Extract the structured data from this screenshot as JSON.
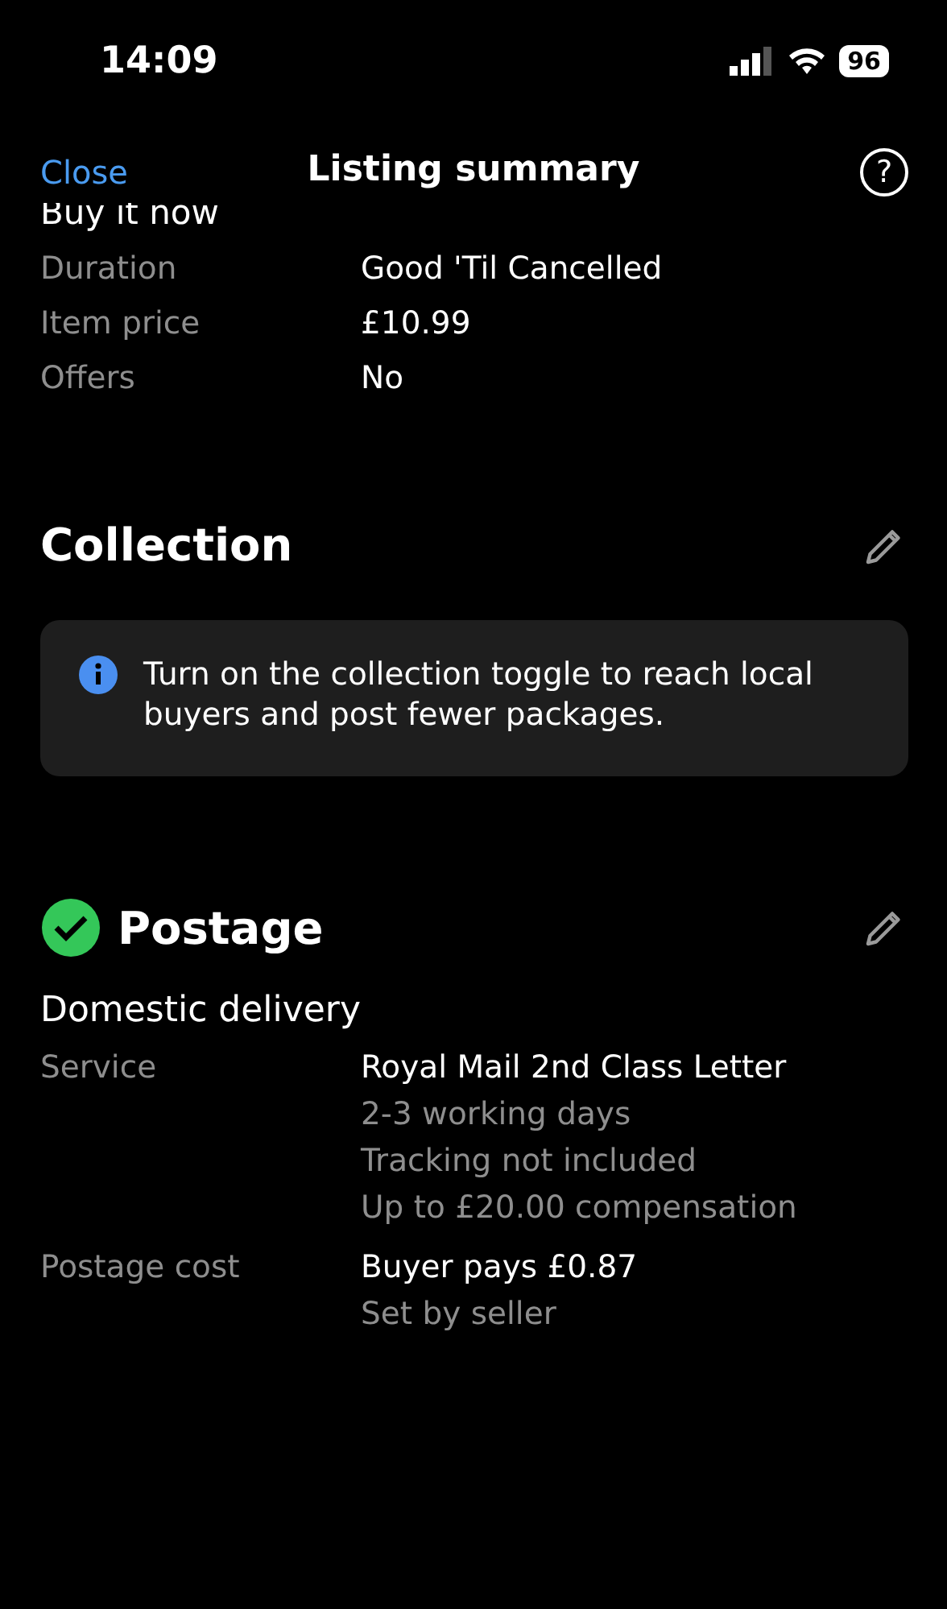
{
  "status_bar": {
    "time": "14:09",
    "battery": "96"
  },
  "nav": {
    "close": "Close",
    "title": "Listing summary",
    "help": "?"
  },
  "buy_it_now": {
    "heading": "Buy it now",
    "rows": [
      {
        "label": "Duration",
        "values": [
          "Good 'Til Cancelled"
        ]
      },
      {
        "label": "Item price",
        "values": [
          "£10.99"
        ]
      },
      {
        "label": "Offers",
        "values": [
          "No"
        ]
      }
    ]
  },
  "collection": {
    "heading": "Collection",
    "complete": false,
    "info": "Turn on the collection toggle to reach local buyers and post fewer packages."
  },
  "postage": {
    "heading": "Postage",
    "complete": true,
    "subheading": "Domestic delivery",
    "rows": [
      {
        "label": "Service",
        "values": [
          "Royal Mail 2nd Class Letter",
          "2-3 working days",
          "Tracking not included",
          "Up to £20.00 compensation"
        ]
      },
      {
        "label": "Postage cost",
        "values": [
          "Buyer pays £0.87",
          "Set by seller"
        ]
      }
    ]
  }
}
